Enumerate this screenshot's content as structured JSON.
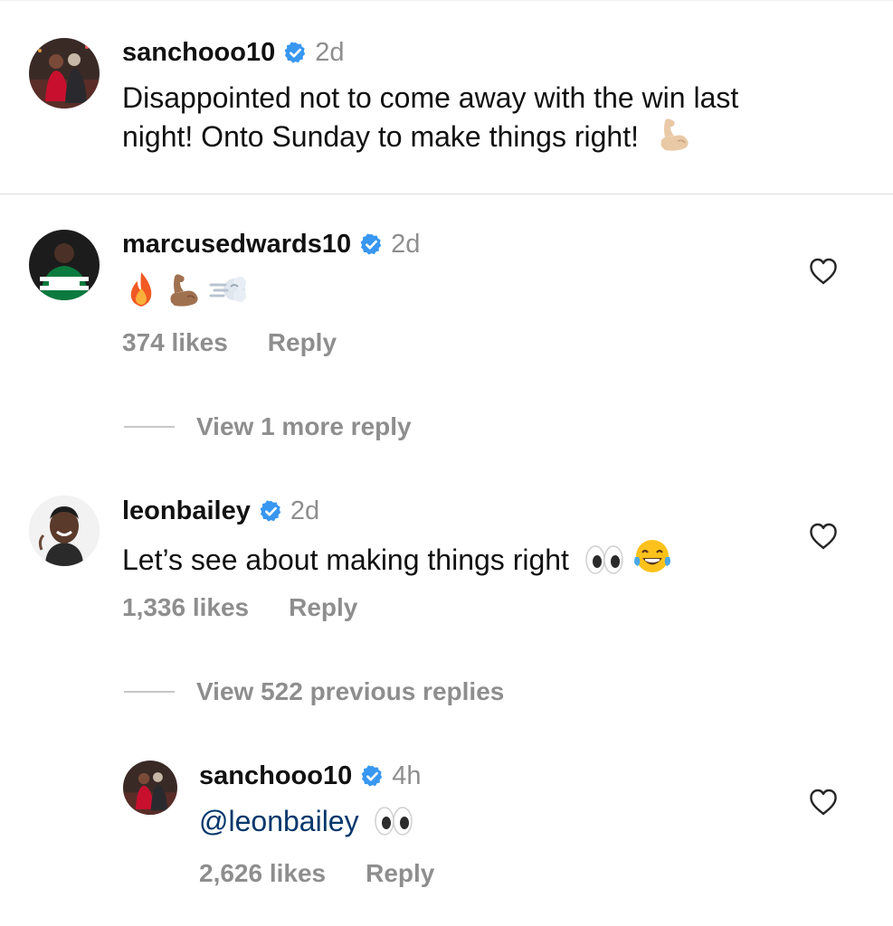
{
  "caption": {
    "username": "sanchooo10",
    "time": "2d",
    "line1": "Disappointed not to come away with the win last",
    "line2": "night! Onto Sunday to make things right!",
    "emoji": "flexed-biceps-light"
  },
  "comments": [
    {
      "username": "marcusedwards10",
      "time": "2d",
      "emojis": [
        "fire",
        "flexed-biceps-medium",
        "dash-symbol"
      ],
      "likes": "374 likes",
      "reply_label": "Reply",
      "view_replies": "View 1 more reply"
    },
    {
      "username": "leonbailey",
      "time": "2d",
      "text": "Let’s see about making things right",
      "emojis": [
        "eyes",
        "face-with-tears-of-joy"
      ],
      "likes": "1,336 likes",
      "reply_label": "Reply",
      "view_replies": "View 522 previous replies"
    }
  ],
  "reply": {
    "username": "sanchooo10",
    "time": "4h",
    "mention": "@leonbailey",
    "emojis": [
      "eyes"
    ],
    "likes": "2,626 likes",
    "reply_label": "Reply"
  },
  "colors": {
    "verified": "#3897f0",
    "secondary_text": "#8e8e8e",
    "mention": "#00376b"
  }
}
